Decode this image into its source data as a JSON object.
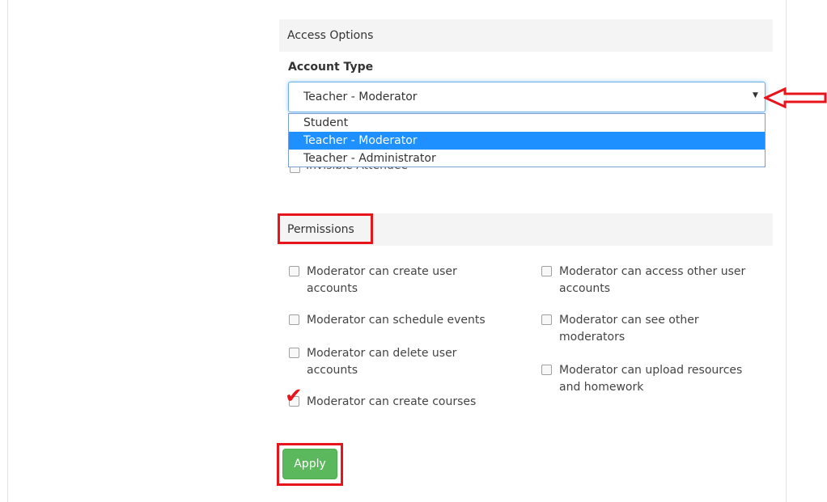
{
  "access": {
    "header": "Access Options"
  },
  "account_type": {
    "label": "Account Type",
    "selected": "Teacher - Moderator",
    "options": [
      "Student",
      "Teacher - Moderator",
      "Teacher - Administrator"
    ]
  },
  "hidden_checkbox_label": "Invisible Attendee",
  "permissions": {
    "header": "Permissions",
    "items": [
      {
        "label": "Moderator can create user accounts",
        "checked": false
      },
      {
        "label": "Moderator can schedule events",
        "checked": false
      },
      {
        "label": "Moderator can delete user accounts",
        "checked": false
      },
      {
        "label": "Moderator can create courses",
        "checked": true
      },
      {
        "label": "Moderator can access other user accounts",
        "checked": false
      },
      {
        "label": "Moderator can see other moderators",
        "checked": false
      },
      {
        "label": "Moderator can upload resources and homework",
        "checked": false
      }
    ]
  },
  "apply_label": "Apply",
  "colors": {
    "annotation": "#e8141c",
    "button": "#5cb85c",
    "highlight": "#1e90ff"
  },
  "icons": {
    "dropdown": "caret-down-icon",
    "annotation_arrow": "left-arrow-annotation-icon",
    "annotation_check": "checkmark-annotation-icon"
  }
}
